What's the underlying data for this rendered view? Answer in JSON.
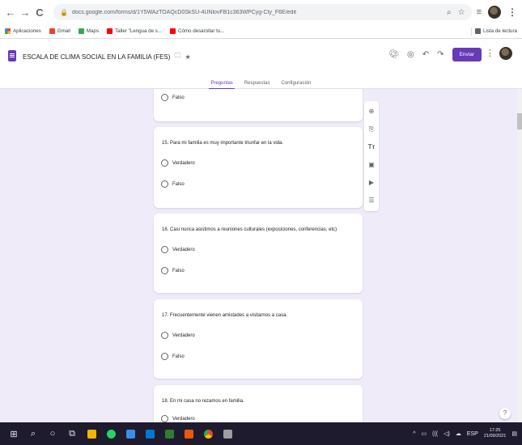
{
  "browser": {
    "back": "←",
    "forward": "→",
    "reload": "C",
    "url": "docs.google.com/forms/d/1Y5WAzTOAQcD0SkSU-4UNlovFB1c363WPCyg-Cty_F6E/edit",
    "bookmarks": [
      {
        "label": "Aplicaciones",
        "icon": "apps-grid-icon",
        "color": "#ea4335"
      },
      {
        "label": "Gmail",
        "icon": "gmail-icon",
        "color": "#ea4335"
      },
      {
        "label": "Maps",
        "icon": "maps-icon",
        "color": "#34a853"
      },
      {
        "label": "Taller \"Lengua de s...",
        "icon": "youtube-icon",
        "color": "#ff0000"
      },
      {
        "label": "Cómo desarollar tu...",
        "icon": "youtube-icon",
        "color": "#ff0000"
      }
    ],
    "reading_list": "Lista de lectura"
  },
  "form": {
    "title": "ESCALA DE CLIMA SOCIAL EN LA FAMILIA (FES)",
    "send_label": "Enviar",
    "tabs": [
      {
        "label": "Preguntas",
        "active": true
      },
      {
        "label": "Respuestas",
        "active": false
      },
      {
        "label": "Configuración",
        "active": false
      }
    ],
    "partial_top_option": "Falso",
    "questions": [
      {
        "text": "15. Para mi familia es muy importante triunfar en la vida.",
        "options": [
          "Verdadero",
          "Falso"
        ]
      },
      {
        "text": "16. Casi nunca asistimos a reuniones culturales (exposiciones, conferencias, etc)",
        "options": [
          "Verdadero",
          "Falso"
        ]
      },
      {
        "text": "17. Frecuentemente vienen amistades a visitarnos a casa.",
        "options": [
          "Verdadero",
          "Falso"
        ]
      },
      {
        "text": "18. En mi casa no rezamos en familia.",
        "options": [
          "Verdadero"
        ]
      }
    ]
  },
  "taskbar": {
    "tray_lang": "ESP",
    "time": "17:25",
    "date": "21/09/2021"
  }
}
